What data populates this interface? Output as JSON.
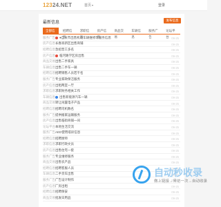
{
  "header": {
    "logo_num": "123",
    "logo_net": "24.NET",
    "nav_label": "首页",
    "login_label": "登录"
  },
  "panel": {
    "title": "最新信息",
    "post_button": "发布信息",
    "tabs": [
      {
        "label": "全部信息",
        "active": true
      },
      {
        "label": "招聘信息"
      },
      {
        "label": "求职信息"
      },
      {
        "label": "房产信息"
      },
      {
        "label": "商品交易"
      },
      {
        "label": "车辆信息"
      },
      {
        "label": "服务广告"
      },
      {
        "label": "论坛平台"
      }
    ]
  },
  "list": [
    {
      "cat": "服务广告",
      "badge": "red",
      "title": "●自贡市出售机动车辆维修等服务信息",
      "date": "09-25"
    },
    {
      "cat": "房产信息",
      "title": "长春高新区出售商铺",
      "date": "09-25"
    },
    {
      "cat": "招聘信息",
      "title": "急招普工多名",
      "date": "09-25"
    },
    {
      "cat": "房产信息",
      "badge": "red",
      "title": "临河路学区房出售",
      "date": "09-25"
    },
    {
      "cat": "商品交易",
      "title": "出售二手家具",
      "date": "09-25"
    },
    {
      "cat": "车辆信息",
      "title": "出售二手车一辆",
      "date": "09-25"
    },
    {
      "cat": "招聘信息",
      "title": "招聘销售人员若干名",
      "date": "09-25"
    },
    {
      "cat": "服务广告",
      "title": "专业家政保洁服务",
      "date": "09-25"
    },
    {
      "cat": "房产信息",
      "title": "出租两室一厅",
      "date": "09-25"
    },
    {
      "cat": "求职信息",
      "title": "求职财务相关工作",
      "date": "09-25"
    },
    {
      "cat": "车辆信息",
      "badge": "blue",
      "title": "出售新能源汽车一辆",
      "date": "09-25"
    },
    {
      "cat": "商品交易",
      "title": "转让闲置电子产品",
      "date": "09-25"
    },
    {
      "cat": "招聘信息",
      "title": "招聘司机数名",
      "date": "09-25"
    },
    {
      "cat": "服务广告",
      "title": "提供搬家运输服务",
      "date": "09-25"
    },
    {
      "cat": "房产信息",
      "title": "出售临街商铺一间",
      "date": "09-25"
    },
    {
      "cat": "论坛平台",
      "title": "本地生活交流",
      "date": "09-25"
    },
    {
      "cat": "服务广告",
      "title": "AED使用培训信息",
      "date": "09-25"
    },
    {
      "cat": "招聘信息",
      "title": "招聘厨师",
      "date": "09-25"
    },
    {
      "cat": "求职信息",
      "title": "求职行政文员",
      "date": "09-25"
    },
    {
      "cat": "房产信息",
      "title": "出售住宅一套",
      "date": "09-25"
    },
    {
      "cat": "服务广告",
      "title": "专业维修服务",
      "date": "09-25"
    },
    {
      "cat": "商品交易",
      "title": "出售农产品",
      "date": "09-25"
    },
    {
      "cat": "招聘信息",
      "title": "招聘客服人员",
      "date": "09-25"
    },
    {
      "cat": "车辆信息",
      "title": "二手货车出售",
      "date": "09-25"
    },
    {
      "cat": "服务广告",
      "title": "广告设计制作",
      "date": "09-25"
    },
    {
      "cat": "房产信息",
      "title": "厂房出租",
      "date": "09-25"
    },
    {
      "cat": "招聘信息",
      "title": "招聘保安",
      "date": "09-25"
    },
    {
      "cat": "商品交易",
      "title": "批发日用品",
      "date": "09-25"
    }
  ],
  "watermark": {
    "title": "自动秒收录",
    "subtitle": "做上链接→来访一次→自动收录"
  }
}
